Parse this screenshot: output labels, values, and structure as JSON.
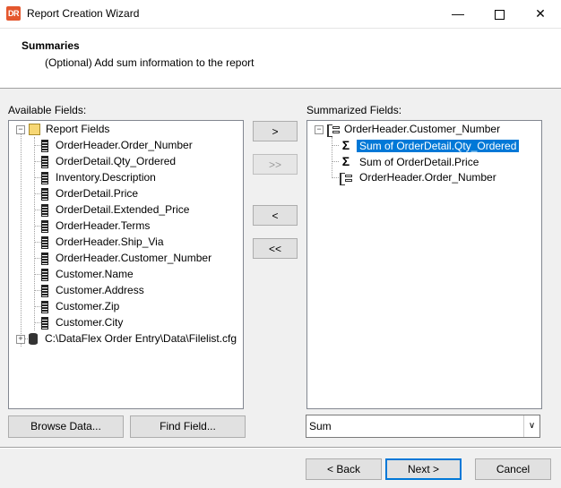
{
  "window": {
    "title": "Report Creation Wizard",
    "icon_text": "DR"
  },
  "header": {
    "title": "Summaries",
    "subtitle": "(Optional) Add sum information to the report"
  },
  "available": {
    "label": "Available Fields:",
    "root_label": "Report Fields",
    "fields": [
      "OrderHeader.Order_Number",
      "OrderDetail.Qty_Ordered",
      "Inventory.Description",
      "OrderDetail.Price",
      "OrderDetail.Extended_Price",
      "OrderHeader.Terms",
      "OrderHeader.Ship_Via",
      "OrderHeader.Customer_Number",
      "Customer.Name",
      "Customer.Address",
      "Customer.Zip",
      "Customer.City"
    ],
    "filelist_label": "C:\\DataFlex Order Entry\\Data\\Filelist.cfg"
  },
  "transfer": {
    "add": ">",
    "add_all": ">>",
    "remove": "<",
    "remove_all": "<<"
  },
  "summarized": {
    "label": "Summarized Fields:",
    "group": "OrderHeader.Customer_Number",
    "items": [
      "Sum of OrderDetail.Qty_Ordered",
      "Sum of OrderDetail.Price"
    ],
    "subgroup": "OrderHeader.Order_Number"
  },
  "buttons": {
    "browse": "Browse Data...",
    "find": "Find Field..."
  },
  "summary_type": {
    "value": "Sum"
  },
  "footer": {
    "back": "< Back",
    "next": "Next >",
    "cancel": "Cancel"
  }
}
